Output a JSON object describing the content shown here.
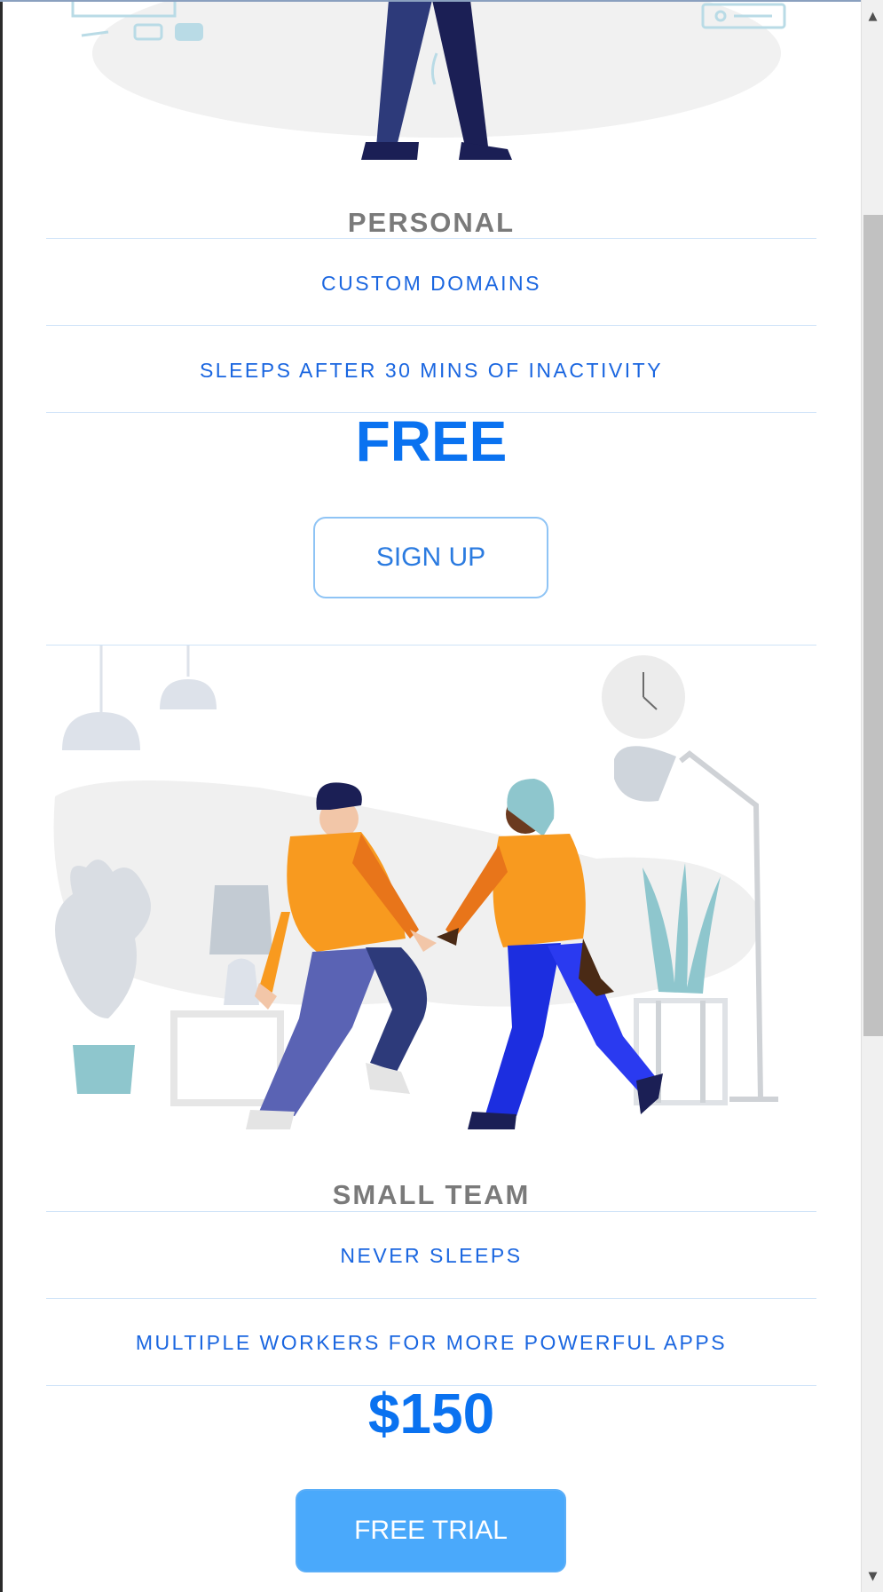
{
  "plans": [
    {
      "title": "PERSONAL",
      "features": [
        "CUSTOM DOMAINS",
        "SLEEPS AFTER 30 MINS OF INACTIVITY"
      ],
      "price": "FREE",
      "cta_label": "SIGN UP"
    },
    {
      "title": "SMALL TEAM",
      "features": [
        "NEVER SLEEPS",
        "MULTIPLE WORKERS FOR MORE POWERFUL APPS"
      ],
      "price": "$150",
      "cta_label": "FREE TRIAL"
    }
  ],
  "scrollbar": {
    "up_icon": "▲",
    "down_icon": "▼"
  },
  "colors": {
    "accent": "#1a66e0",
    "price": "#0a72f0",
    "cta_solid": "#4aa9fb",
    "divider": "#cfe3f8",
    "title_gray": "#7a7a7a"
  }
}
